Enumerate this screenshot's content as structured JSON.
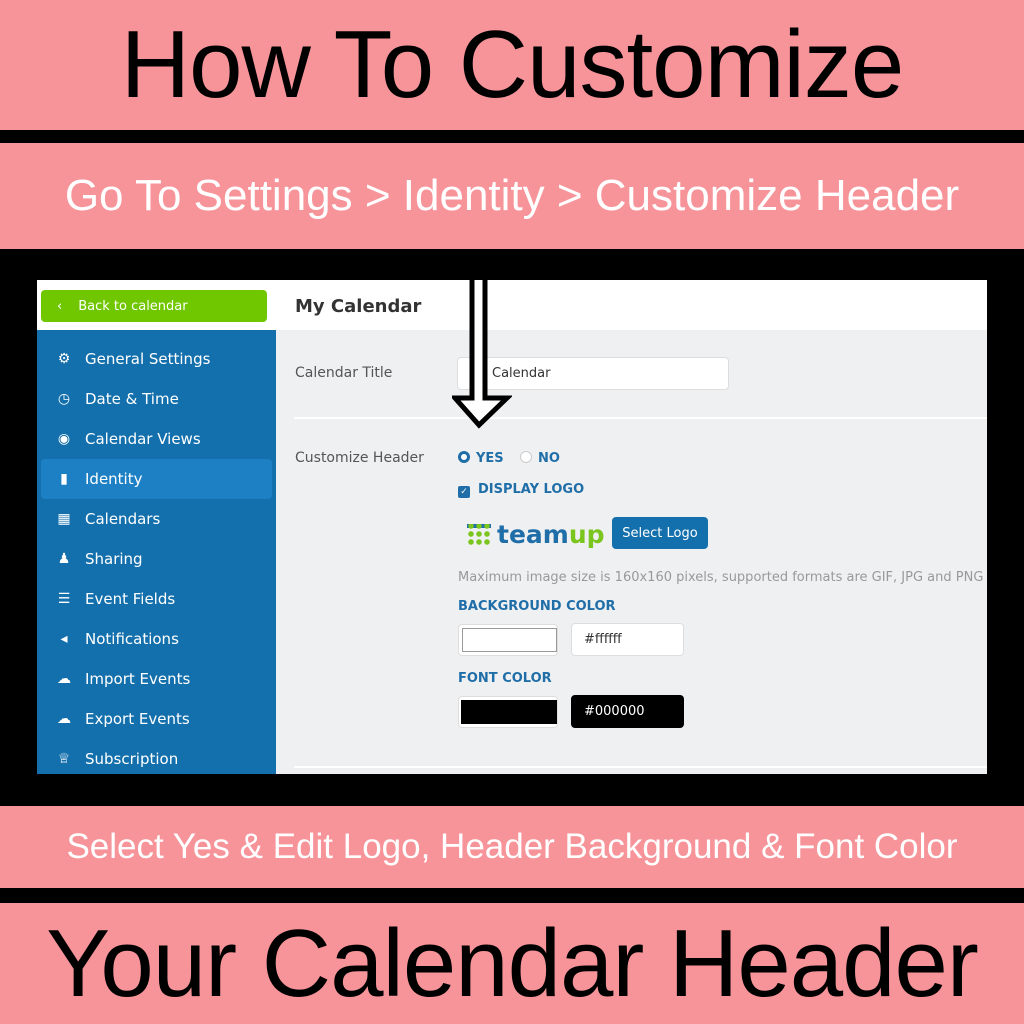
{
  "banner": {
    "title_top": "How To Customize",
    "step": "Go To Settings > Identity > Customize Header",
    "instruction": "Select Yes & Edit Logo, Header Background & Font Color",
    "title_bottom": "Your Calendar Header"
  },
  "sidebar": {
    "back_label": "Back to calendar",
    "items": [
      {
        "label": "General Settings",
        "icon": "gear-icon"
      },
      {
        "label": "Date & Time",
        "icon": "clock-icon"
      },
      {
        "label": "Calendar Views",
        "icon": "eye-icon"
      },
      {
        "label": "Identity",
        "icon": "bookmark-icon",
        "active": true
      },
      {
        "label": "Calendars",
        "icon": "calendar-icon"
      },
      {
        "label": "Sharing",
        "icon": "users-icon"
      },
      {
        "label": "Event Fields",
        "icon": "list-icon"
      },
      {
        "label": "Notifications",
        "icon": "volume-icon"
      },
      {
        "label": "Import Events",
        "icon": "cloud-upload-icon"
      },
      {
        "label": "Export Events",
        "icon": "cloud-download-icon"
      },
      {
        "label": "Subscription",
        "icon": "trophy-icon"
      }
    ]
  },
  "main": {
    "header": "My Calendar",
    "calendar_title_label": "Calendar Title",
    "calendar_title_value": "Calendar",
    "customize_header_label": "Customize Header",
    "yes": "YES",
    "no": "NO",
    "customize_selected": "YES",
    "display_logo": "DISPLAY LOGO",
    "display_logo_checked": true,
    "logo_text_a": "team",
    "logo_text_b": "up",
    "select_logo": "Select Logo",
    "logo_hint": "Maximum image size is 160x160 pixels, supported formats are GIF, JPG and PNG",
    "bg_color_label": "BACKGROUND COLOR",
    "bg_color": "#ffffff",
    "font_color_label": "FONT COLOR",
    "font_color": "#000000"
  },
  "colors": {
    "banner": "#f7949a",
    "sidebar": "#1470ad",
    "back_button": "#70c700"
  }
}
